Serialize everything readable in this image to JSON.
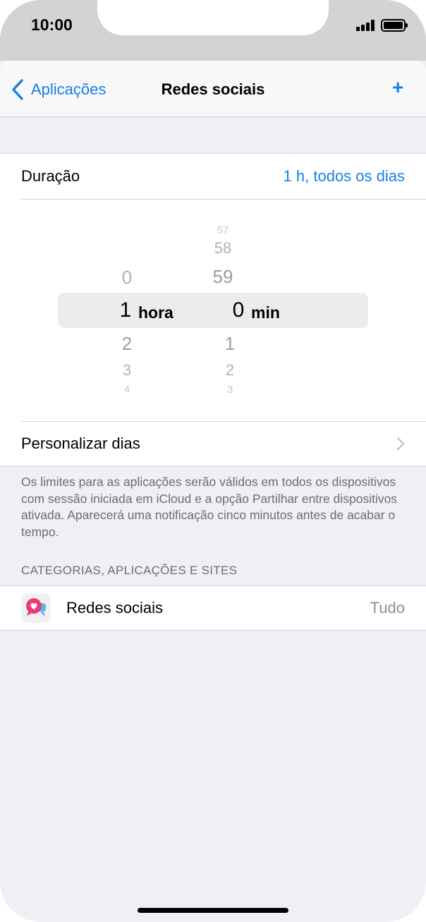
{
  "status_bar": {
    "time": "10:00",
    "signal_icon": "cellular-signal-icon",
    "battery_icon": "battery-full-icon"
  },
  "nav": {
    "back_label": "Aplicações",
    "back_icon": "chevron-left-icon",
    "title": "Redes sociais",
    "add_label": "+"
  },
  "duration": {
    "label": "Duração",
    "value": "1 h, todos os dias"
  },
  "picker": {
    "hours": {
      "above": [
        "0"
      ],
      "selected": "1",
      "below": [
        "2",
        "3",
        "4"
      ],
      "unit": "hora"
    },
    "minutes": {
      "above": [
        "57",
        "58",
        "59"
      ],
      "selected": "0",
      "below": [
        "1",
        "2",
        "3"
      ],
      "unit": "min"
    }
  },
  "customize_days": {
    "label": "Personalizar dias",
    "chevron_icon": "chevron-right-icon"
  },
  "footnote": "Os limites para as aplicações serão válidos em todos os dispositivos com sessão iniciada em iCloud e a opção Partilhar entre dispositivos ativada. Aparecerá uma notificação cinco minutos antes de acabar o tempo.",
  "categories": {
    "header": "CATEGORIAS, APLICAÇÕES E SITES",
    "items": [
      {
        "icon": "social-chat-bubbles-icon",
        "label": "Redes sociais",
        "value": "Tudo"
      }
    ]
  },
  "colors": {
    "accent": "#1a7ee8",
    "background": "#f0eff5",
    "secondary_text": "#6d6d72"
  }
}
